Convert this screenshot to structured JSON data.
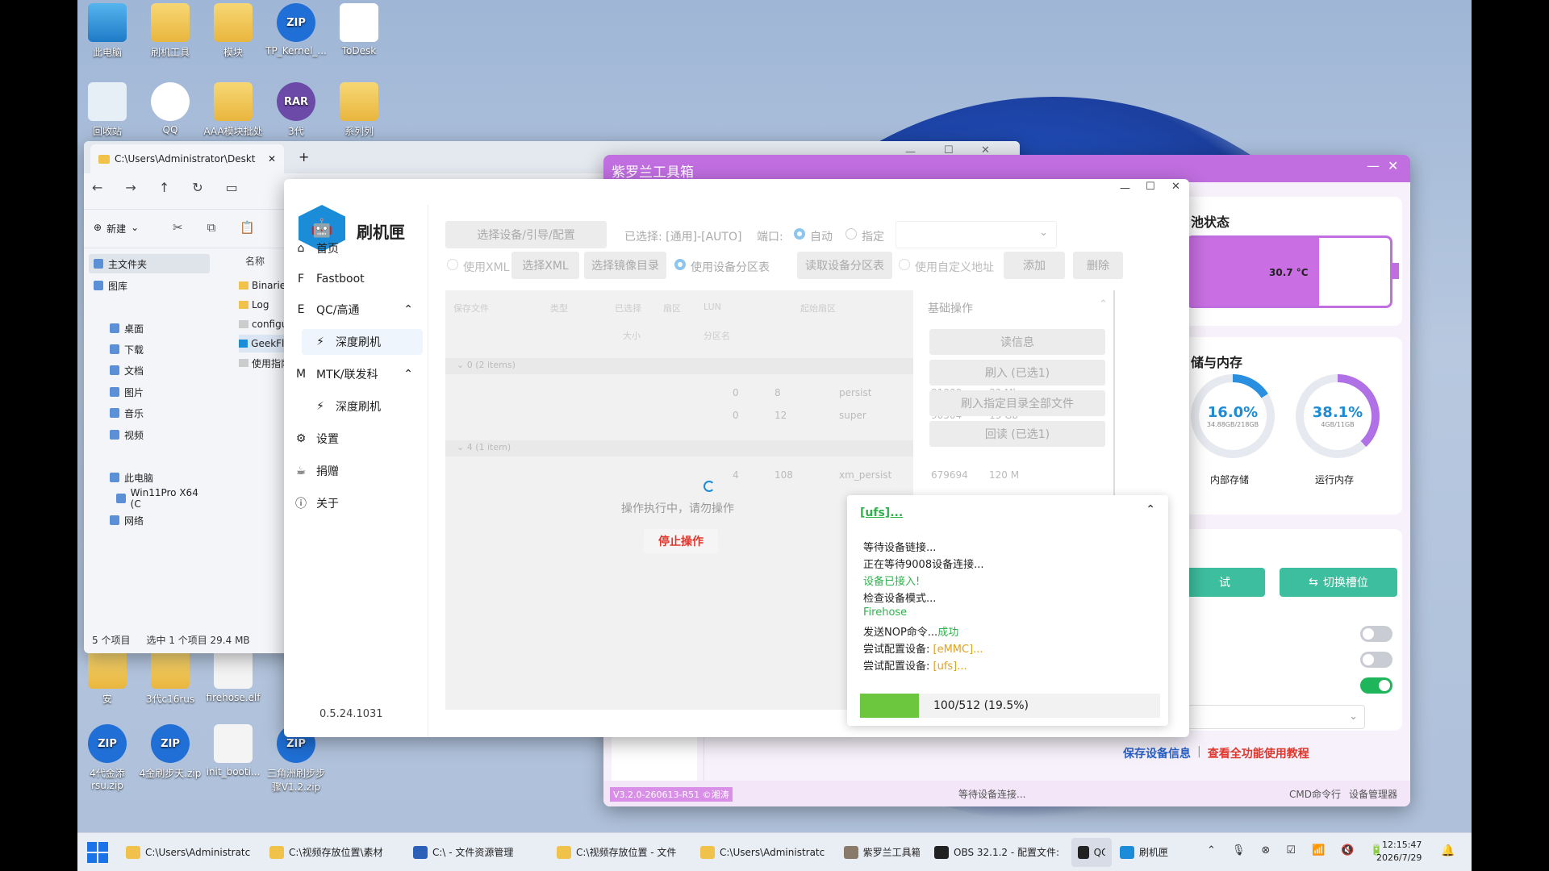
{
  "desktop_icons": [
    {
      "label": "此电脑",
      "kind": "pc"
    },
    {
      "label": "刷机工具",
      "kind": "folder"
    },
    {
      "label": "模块",
      "kind": "folder"
    },
    {
      "label": "TP_Kernel_...",
      "kind": "zip",
      "badge": "ZIP"
    },
    {
      "label": "ToDesk",
      "kind": "todesk"
    },
    {
      "label": "回收站",
      "kind": "bin"
    },
    {
      "label": "QQ",
      "kind": "qq"
    },
    {
      "label": "AAA模块批处",
      "kind": "folder"
    },
    {
      "label": "3代",
      "kind": "rar",
      "badge": "RAR"
    },
    {
      "label": "系列列",
      "kind": "folder"
    },
    {
      "label": "安",
      "kind": "folder"
    },
    {
      "label": "3代c16rus",
      "kind": "folder"
    },
    {
      "label": "firehose.elf",
      "kind": "file"
    },
    {
      "label": "4代金添rsu.zip",
      "kind": "zip",
      "badge": "ZIP"
    },
    {
      "label": "4金刷步天.zip",
      "kind": "zip",
      "badge": "ZIP"
    },
    {
      "label": "init_booti...",
      "kind": "file"
    },
    {
      "label": "三角洲刷步步骤V1.2.zip",
      "kind": "zip",
      "badge": "ZIP"
    }
  ],
  "explorer": {
    "tab_title": "C:\\Users\\Administrator\\Deskt",
    "new_btn": "新建",
    "sidebar": [
      "主文件夹",
      "图库",
      "桌面",
      "下载",
      "文档",
      "图片",
      "音乐",
      "视频",
      "此电脑",
      "Win11Pro X64 (C",
      "网络"
    ],
    "col_name": "名称",
    "files": [
      "Binaries",
      "Log",
      "configur",
      "GeekFlas",
      "使用指南"
    ],
    "status_count": "5 个项目",
    "status_sel": "选中 1 个项目  29.4 MB"
  },
  "zlt": {
    "title": "紫罗兰工具箱",
    "battery_title": "池状态",
    "temp": "30.7 °C",
    "storage_title": "储与内存",
    "internal_pct": "16.0%",
    "internal_sub": "34.88GB/218GB",
    "internal_label": "内部存储",
    "internal_val": 0.16,
    "ram_pct": "38.1%",
    "ram_sub": "4GB/11GB",
    "ram_label": "运行内存",
    "ram_val": 0.381,
    "btn_test": "试",
    "btn_switch": "切换槽位",
    "link_save": "保存设备信息",
    "link_guide": "查看全功能使用教程",
    "version": "V3.2.0-260613-R51 ©湘涛",
    "status": "等待设备连接...",
    "bottom_cmd": "CMD命令行",
    "bottom_dev": "设备管理器",
    "accent": "#b45fd4"
  },
  "flash": {
    "app_name": "刷机匣",
    "nav": [
      "首页",
      "Fastboot",
      "QC/高通",
      "深度刷机",
      "MTK/联发科",
      "深度刷机",
      "设置",
      "捐赠",
      "关于"
    ],
    "version": "0.5.24.1031",
    "btn_select_device": "选择设备/引导/配置",
    "selected_label": "已选择: [通用]-[AUTO]",
    "port_label": "端口:",
    "port_auto": "自动",
    "port_manual": "指定",
    "use_xml": "使用XML",
    "select_xml": "选择XML",
    "select_dir": "选择镜像目录",
    "use_part": "使用设备分区表",
    "read_part": "读取设备分区表",
    "use_custom": "使用自定义地址",
    "add": "添加",
    "delete": "删除",
    "table_headers": [
      "保存文件",
      "类型",
      "已选择",
      "扇区",
      "LUN",
      "起始扇区",
      "大小",
      "分区名"
    ],
    "group1": "0 (2 items)",
    "group2": "4 (1 item)",
    "rows": [
      [
        "0",
        "8",
        "persist",
        "81800",
        "32 Mb"
      ],
      [
        "0",
        "12",
        "super",
        "90504",
        "13 Gb"
      ],
      [
        "4",
        "108",
        "xm_persist",
        "679694",
        "120 M"
      ]
    ],
    "busy_text": "操作执行中，请勿操作",
    "stop_btn": "停止操作",
    "basic_ops": "基础操作",
    "ops": [
      "读信息",
      "刷入 (已选1)",
      "刷入指定目录全部文件",
      "回读 (已选1)"
    ],
    "log_title": "[ufs]...",
    "log": [
      {
        "t": "等待设备链接...",
        "c": "#222"
      },
      {
        "t": "正在等待9008设备连接...",
        "c": "#222"
      },
      {
        "t": "设备已接入!",
        "c": "#2fb24c"
      },
      {
        "t": "检查设备模式...",
        "c": "#222"
      },
      {
        "t": "Firehose",
        "c": "#2fb24c"
      },
      {
        "t": "发送NOP命令...",
        "c": "#222",
        "s": "成功",
        "sc": "#2fb24c"
      },
      {
        "t": "尝试配置设备: ",
        "c": "#222",
        "s": "[eMMC]...",
        "sc": "#e0a020"
      },
      {
        "t": "尝试配置设备: ",
        "c": "#222",
        "s": "[ufs]...",
        "sc": "#e0a020"
      }
    ],
    "progress_text": "100/512 (19.5%)",
    "progress": 0.195,
    "brand": "#1a8cd8"
  },
  "taskbar": [
    {
      "label": "C:\\Users\\Administratc",
      "c": "#f0c24a"
    },
    {
      "label": "C:\\视频存放位置\\素材",
      "c": "#f0c24a"
    },
    {
      "label": "C:\\ - 文件资源管理",
      "c": "#2b5fb8"
    },
    {
      "label": "C:\\视频存放位置 - 文件",
      "c": "#f0c24a"
    },
    {
      "label": "C:\\Users\\Administratc",
      "c": "#f0c24a"
    },
    {
      "label": "紫罗兰工具箱",
      "c": "#8a7a6a"
    },
    {
      "label": "OBS 32.1.2 - 配置文件:",
      "c": "#222"
    },
    {
      "label": "QQ",
      "c": "#222"
    },
    {
      "label": "刷机匣",
      "c": "#1a8cd8"
    }
  ],
  "clock_time": "12:15:47",
  "clock_date": "2026/7/29"
}
